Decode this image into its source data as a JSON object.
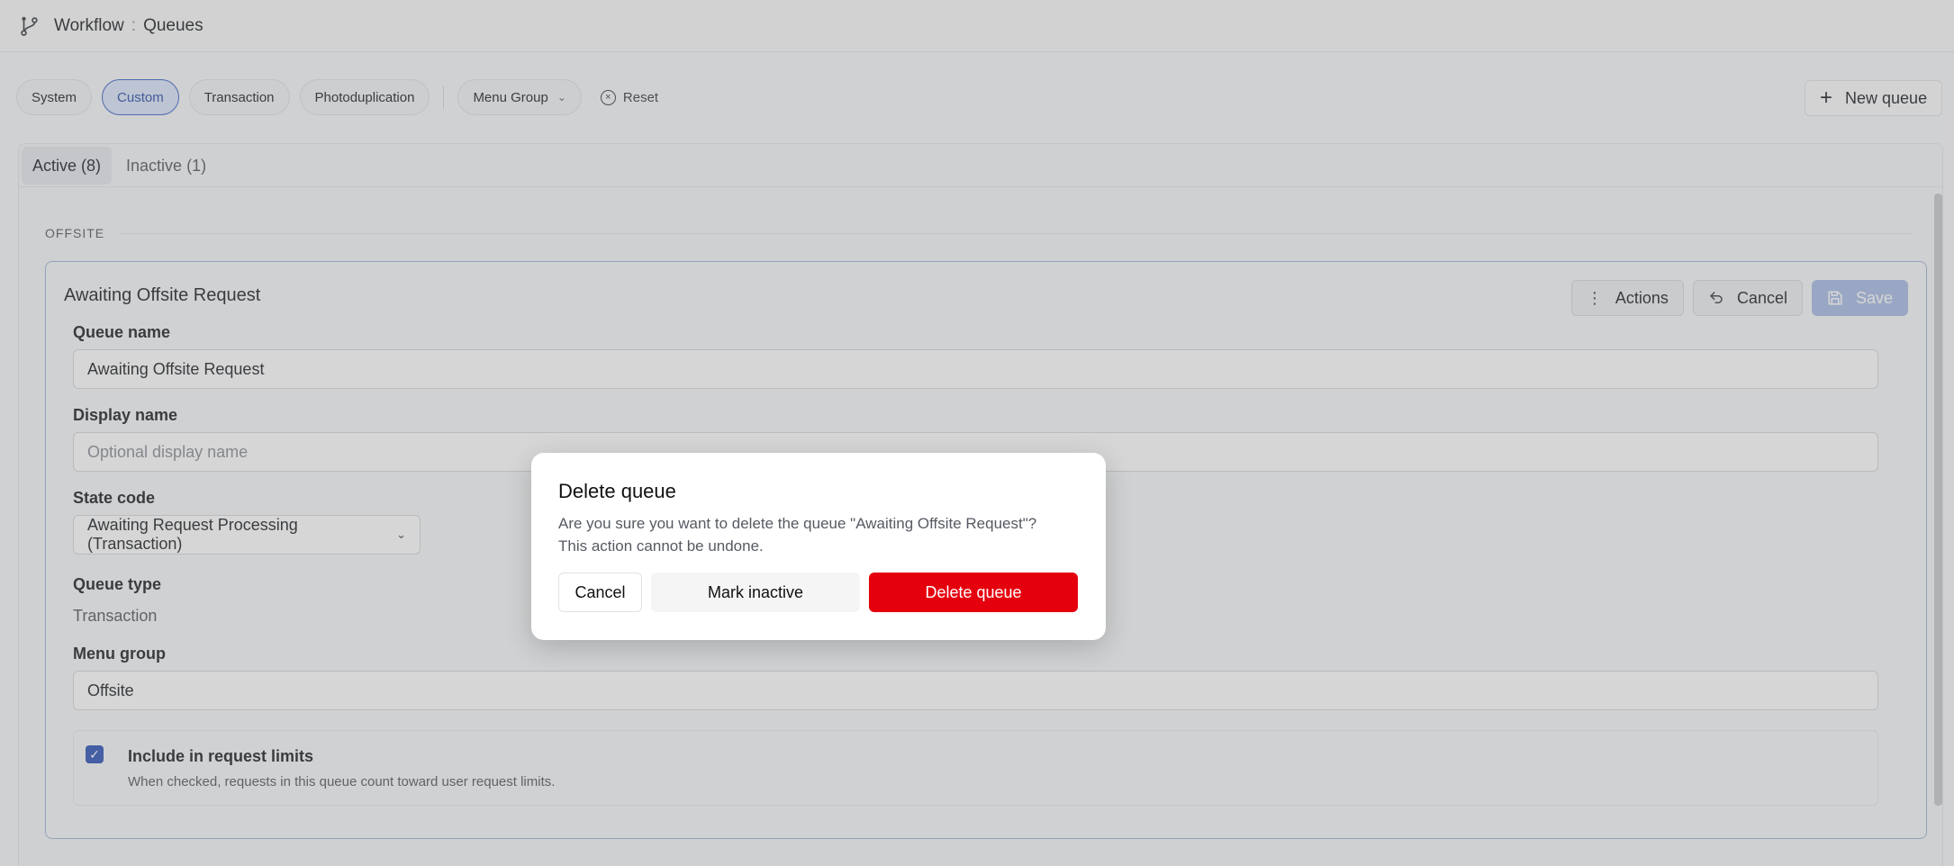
{
  "header": {
    "crumb_root": "Workflow",
    "crumb_sep": ":",
    "crumb_current": "Queues",
    "icon": "git-branch-icon"
  },
  "filters": {
    "chips": [
      "System",
      "Custom",
      "Transaction",
      "Photoduplication"
    ],
    "active_chip": "Custom",
    "menu_group_label": "Menu Group",
    "reset_label": "Reset",
    "accent": "#3b63c8"
  },
  "new_queue_label": "New queue",
  "tabs": [
    {
      "label": "Active (8)",
      "active": true
    },
    {
      "label": "Inactive (1)",
      "active": false
    }
  ],
  "section_label": "OFFSITE",
  "card": {
    "title": "Awaiting Offsite Request",
    "actions_label": "Actions",
    "cancel_label": "Cancel",
    "save_label": "Save",
    "queue_name_label": "Queue name",
    "queue_name_value": "Awaiting Offsite Request",
    "display_name_label": "Display name",
    "display_name_placeholder": "Optional display name",
    "state_code_label": "State code",
    "state_code_value": "Awaiting Request Processing (Transaction)",
    "queue_type_label": "Queue type",
    "queue_type_value": "Transaction",
    "menu_group_label": "Menu group",
    "menu_group_value": "Offsite",
    "checkbox_label": "Include in request limits",
    "checkbox_help": "When checked, requests in this queue count toward user request limits.",
    "checkbox_checked": true
  },
  "dialog": {
    "title": "Delete queue",
    "message_line1": "Are you sure you want to delete the queue \"Awaiting Offsite Request\"?",
    "message_line2": "This action cannot be undone.",
    "cancel_label": "Cancel",
    "mark_inactive_label": "Mark inactive",
    "delete_label": "Delete queue",
    "danger_color": "#e5000e"
  }
}
